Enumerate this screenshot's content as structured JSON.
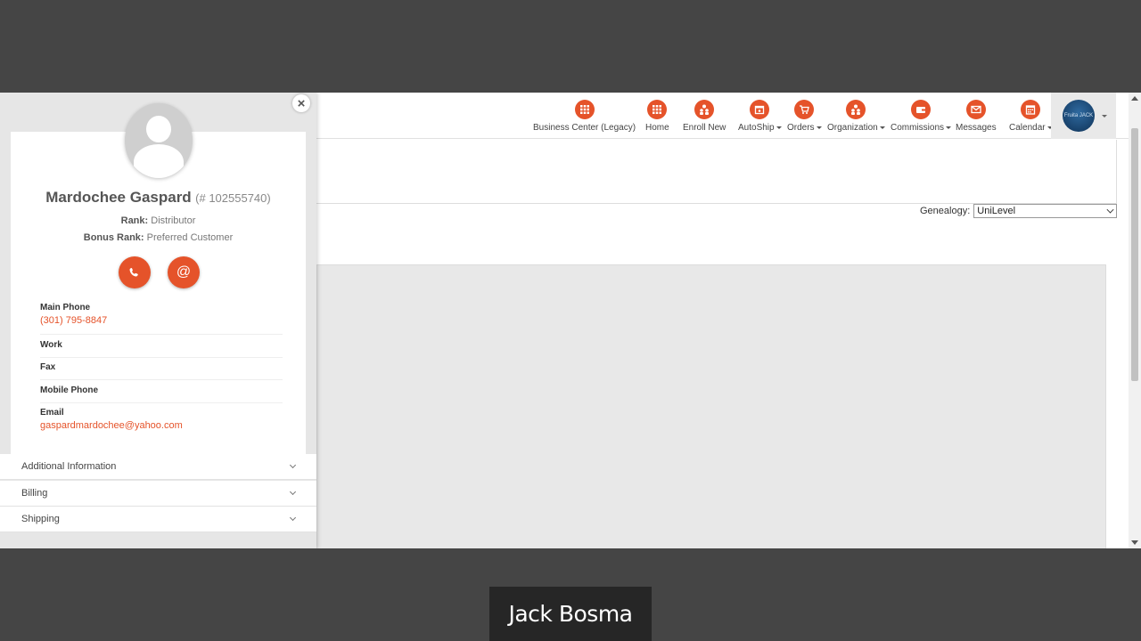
{
  "nav": {
    "items": [
      {
        "label": "Business Center (Legacy)",
        "icon": "grid-icon",
        "dropdown": false
      },
      {
        "label": "Home",
        "icon": "grid-icon",
        "dropdown": false
      },
      {
        "label": "Enroll New",
        "icon": "people-icon",
        "dropdown": false
      },
      {
        "label": "AutoShip",
        "icon": "calendar-icon",
        "dropdown": true
      },
      {
        "label": "Orders",
        "icon": "cart-icon",
        "dropdown": true
      },
      {
        "label": "Organization",
        "icon": "people-icon",
        "dropdown": true
      },
      {
        "label": "Commissions",
        "icon": "wallet-icon",
        "dropdown": true
      },
      {
        "label": "Messages",
        "icon": "envelope-icon",
        "dropdown": false
      },
      {
        "label": "Calendar",
        "icon": "calendar-icon",
        "dropdown": true
      }
    ],
    "avatar_text": "Fruita JACK"
  },
  "genealogy": {
    "label": "Genealogy:",
    "selected": "UniLevel"
  },
  "contact": {
    "name": "Mardochee Gaspard",
    "id": "(# 102555740)",
    "rank_label": "Rank:",
    "rank": "Distributor",
    "bonus_rank_label": "Bonus Rank:",
    "bonus_rank": "Preferred Customer",
    "fields": [
      {
        "label": "Main Phone",
        "value": "(301) 795-8847"
      },
      {
        "label": "Work",
        "value": ""
      },
      {
        "label": "Fax",
        "value": ""
      },
      {
        "label": "Mobile Phone",
        "value": ""
      },
      {
        "label": "Email",
        "value": "gaspardmardochee@yahoo.com"
      }
    ],
    "sections": [
      "Additional Information",
      "Billing",
      "Shipping"
    ]
  },
  "presenter": {
    "name": "Jack Bosma"
  },
  "colors": {
    "accent": "#e5532a",
    "backdrop": "#454545"
  }
}
